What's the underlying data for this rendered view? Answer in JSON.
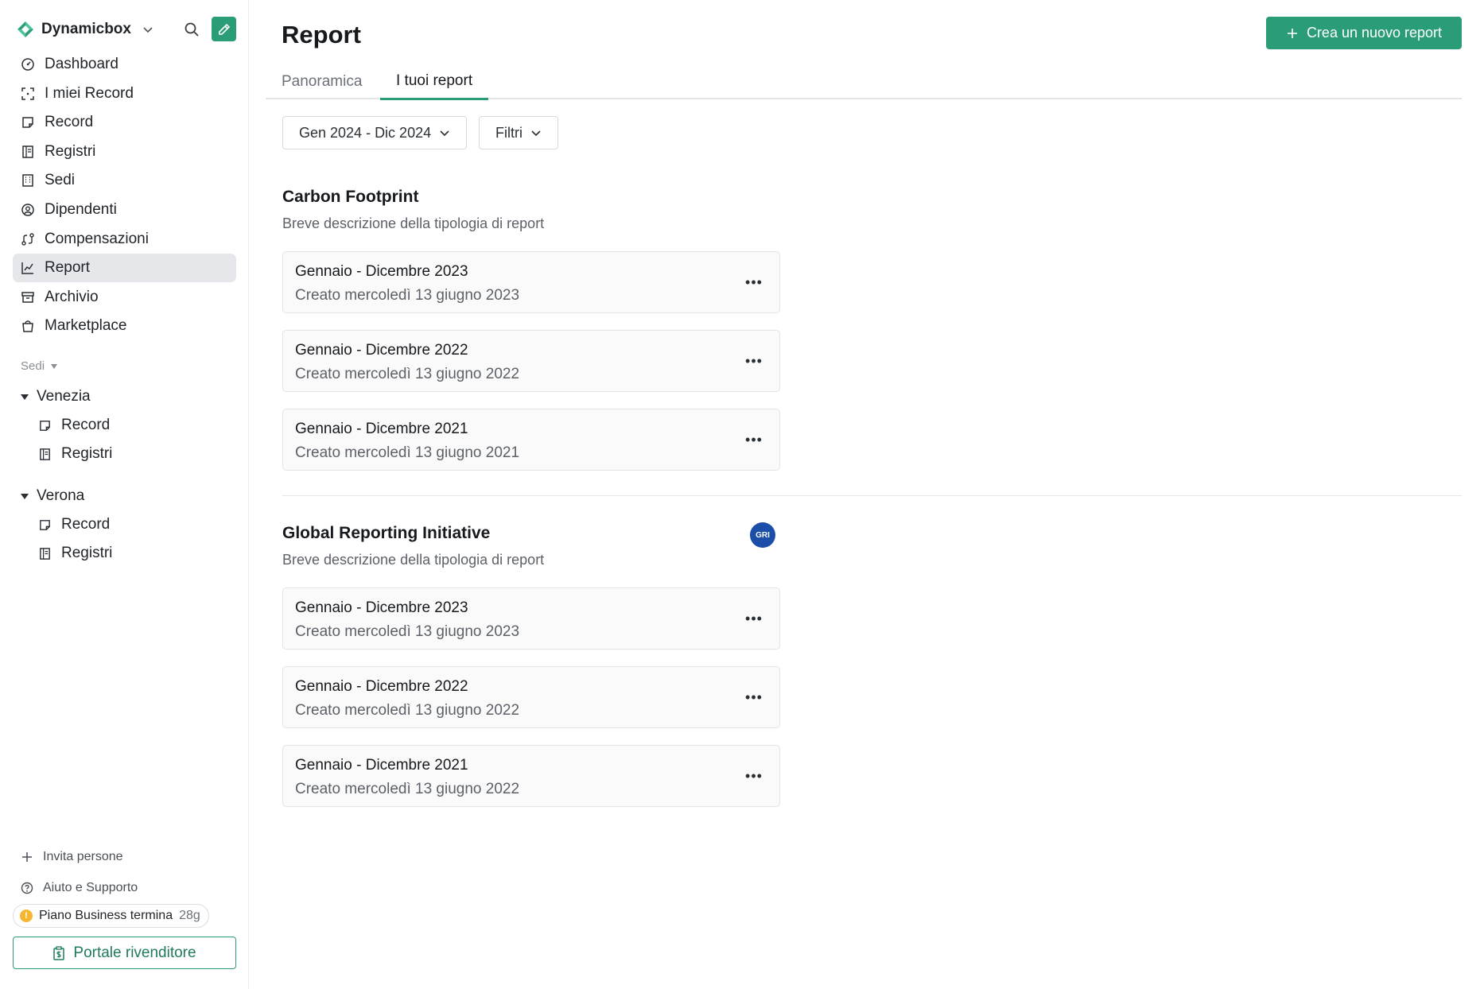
{
  "sidebar": {
    "brand": "Dynamicbox",
    "nav": [
      {
        "label": "Dashboard",
        "icon": "dashboard-icon"
      },
      {
        "label": "I miei Record",
        "icon": "scan-icon"
      },
      {
        "label": "Record",
        "icon": "note-icon"
      },
      {
        "label": "Registri",
        "icon": "ledger-icon"
      },
      {
        "label": "Sedi",
        "icon": "building-icon"
      },
      {
        "label": "Dipendenti",
        "icon": "user-circle-icon"
      },
      {
        "label": "Compensazioni",
        "icon": "exchange-icon"
      },
      {
        "label": "Report",
        "icon": "chart-icon",
        "active": true
      },
      {
        "label": "Archivio",
        "icon": "archive-icon"
      },
      {
        "label": "Marketplace",
        "icon": "bag-icon"
      }
    ],
    "sedi_label": "Sedi",
    "locations": [
      {
        "name": "Venezia",
        "items": [
          "Record",
          "Registri"
        ]
      },
      {
        "name": "Verona",
        "items": [
          "Record",
          "Registri"
        ]
      }
    ],
    "invite_label": "Invita persone",
    "help_label": "Aiuto e Supporto",
    "plan_label": "Piano Business termina",
    "plan_days": "28g",
    "plan_badge_icon": "!",
    "portal_label": "Portale rivenditore"
  },
  "header": {
    "title": "Report",
    "create_label": "Crea un nuovo report",
    "tabs": [
      {
        "label": "Panoramica",
        "active": false
      },
      {
        "label": "I tuoi report",
        "active": true
      }
    ]
  },
  "filters": {
    "date_range": "Gen 2024 - Dic 2024",
    "filters_label": "Filtri"
  },
  "sections": [
    {
      "title": "Carbon Footprint",
      "description": "Breve descrizione della tipologia di report",
      "badge": "",
      "reports": [
        {
          "title": "Gennaio - Dicembre 2023",
          "created": "Creato mercoledì 13 giugno 2023"
        },
        {
          "title": "Gennaio - Dicembre 2022",
          "created": "Creato mercoledì 13 giugno 2022"
        },
        {
          "title": "Gennaio - Dicembre 2021",
          "created": "Creato mercoledì 13 giugno 2021"
        }
      ]
    },
    {
      "title": "Global Reporting Initiative",
      "description": "Breve descrizione della tipologia di report",
      "badge": "GRI",
      "reports": [
        {
          "title": "Gennaio - Dicembre 2023",
          "created": "Creato mercoledì 13 giugno 2023"
        },
        {
          "title": "Gennaio - Dicembre 2022",
          "created": "Creato mercoledì 13 giugno 2022"
        },
        {
          "title": "Gennaio - Dicembre 2021",
          "created": "Creato mercoledì 13 giugno 2022"
        }
      ]
    }
  ],
  "card_menu_glyph": "•••",
  "colors": {
    "accent": "#2a9d78",
    "active_nav_bg": "#e6e7ea",
    "gri_badge": "#1a4ea8",
    "plan_warning": "#f5b731"
  }
}
